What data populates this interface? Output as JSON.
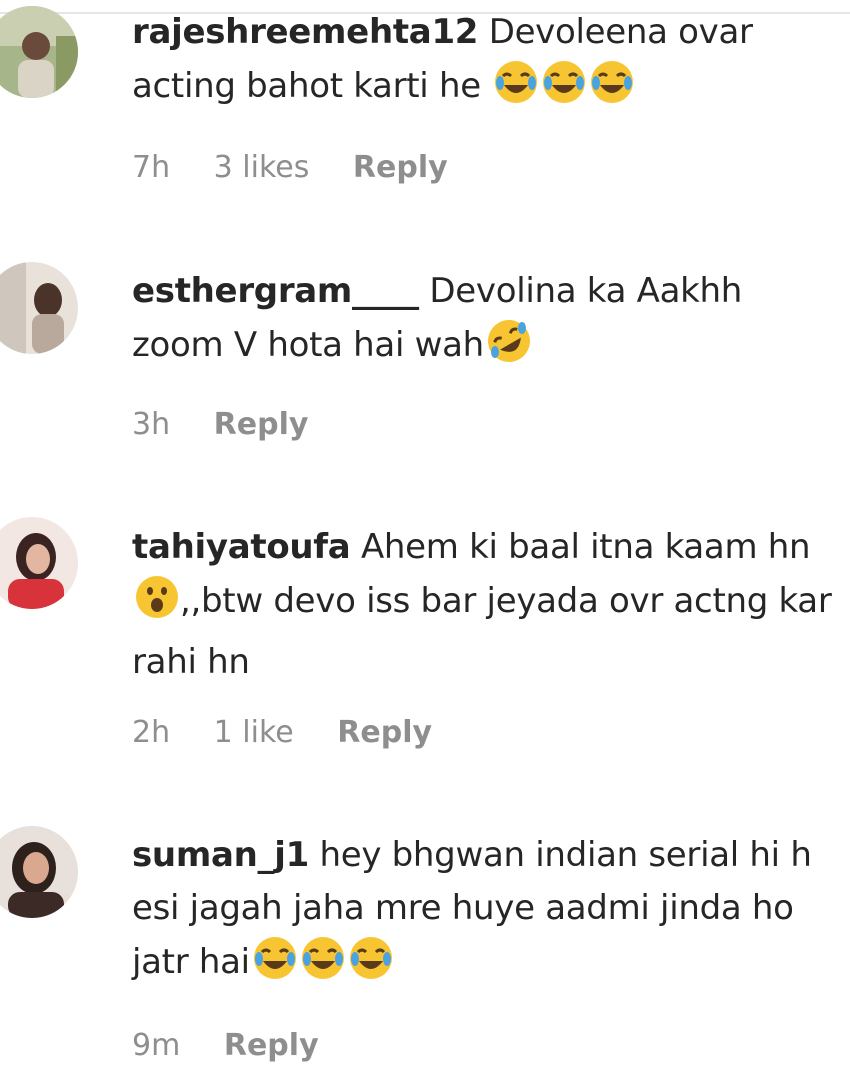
{
  "comments": [
    {
      "username": "rajeshreemehta12",
      "text": "Devoleena ovar acting bahot karti he",
      "emojis": [
        "face-with-tears-of-joy",
        "face-with-tears-of-joy",
        "face-with-tears-of-joy"
      ],
      "time": "7h",
      "likes": "3 likes",
      "reply": "Reply"
    },
    {
      "username": "esthergram____",
      "text": "Devolina ka Aakhh zoom V hota hai wah",
      "emojis": [
        "rolling-on-the-floor-laughing"
      ],
      "time": "3h",
      "reply": "Reply"
    },
    {
      "username": "tahiyatoufa",
      "text_before": "Ahem ki baal itna kaam hn",
      "emoji_inline": "face-with-open-mouth",
      "text_after": ",,btw devo iss bar jeyada ovr actng kar rahi hn",
      "time": "2h",
      "likes": "1 like",
      "reply": "Reply"
    },
    {
      "username": "suman_j1",
      "text": "hey bhgwan indian serial hi h esi jagah jaha mre huye aadmi jinda ho jatr hai",
      "emojis": [
        "face-with-tears-of-joy",
        "face-with-tears-of-joy",
        "face-with-tears-of-joy"
      ],
      "time": "9m",
      "reply": "Reply"
    }
  ],
  "colors": {
    "text": "#262626",
    "meta": "#8e8e8e",
    "emoji_yellow": "#f7c531",
    "tear_blue": "#4aa3df"
  }
}
